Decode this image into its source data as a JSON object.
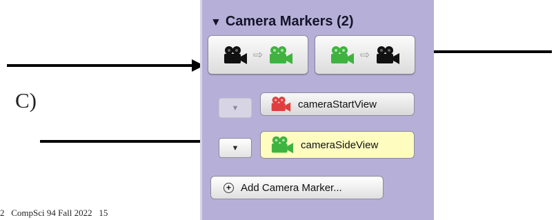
{
  "annotation": {
    "label": "C)",
    "footer": "2   CompSci 94 Fall 2022   15"
  },
  "panel": {
    "header": {
      "toggle_glyph": "▼",
      "title": "Camera Markers (2)"
    },
    "swap_buttons": [
      {
        "from_icon": "black-camera-icon",
        "to_icon": "green-camera-icon"
      },
      {
        "from_icon": "green-camera-icon",
        "to_icon": "black-camera-icon"
      }
    ],
    "markers": [
      {
        "name": "cameraStartView",
        "icon": "red-camera-icon",
        "color": "#e13d3d",
        "collapse_glyph": "▼",
        "selected": false
      },
      {
        "name": "cameraSideView",
        "icon": "green-camera-icon",
        "color": "#3fb33f",
        "collapse_glyph": "▼",
        "selected": true
      }
    ],
    "add_button": {
      "label": "Add Camera Marker..."
    }
  },
  "colors": {
    "panel_bg": "#b6b0d8",
    "camera_black": "#111111",
    "camera_green": "#3fb33f",
    "camera_red": "#e13d3d",
    "selected_bg": "#fffcbf",
    "swap_arrow": "#9d9d9d"
  }
}
